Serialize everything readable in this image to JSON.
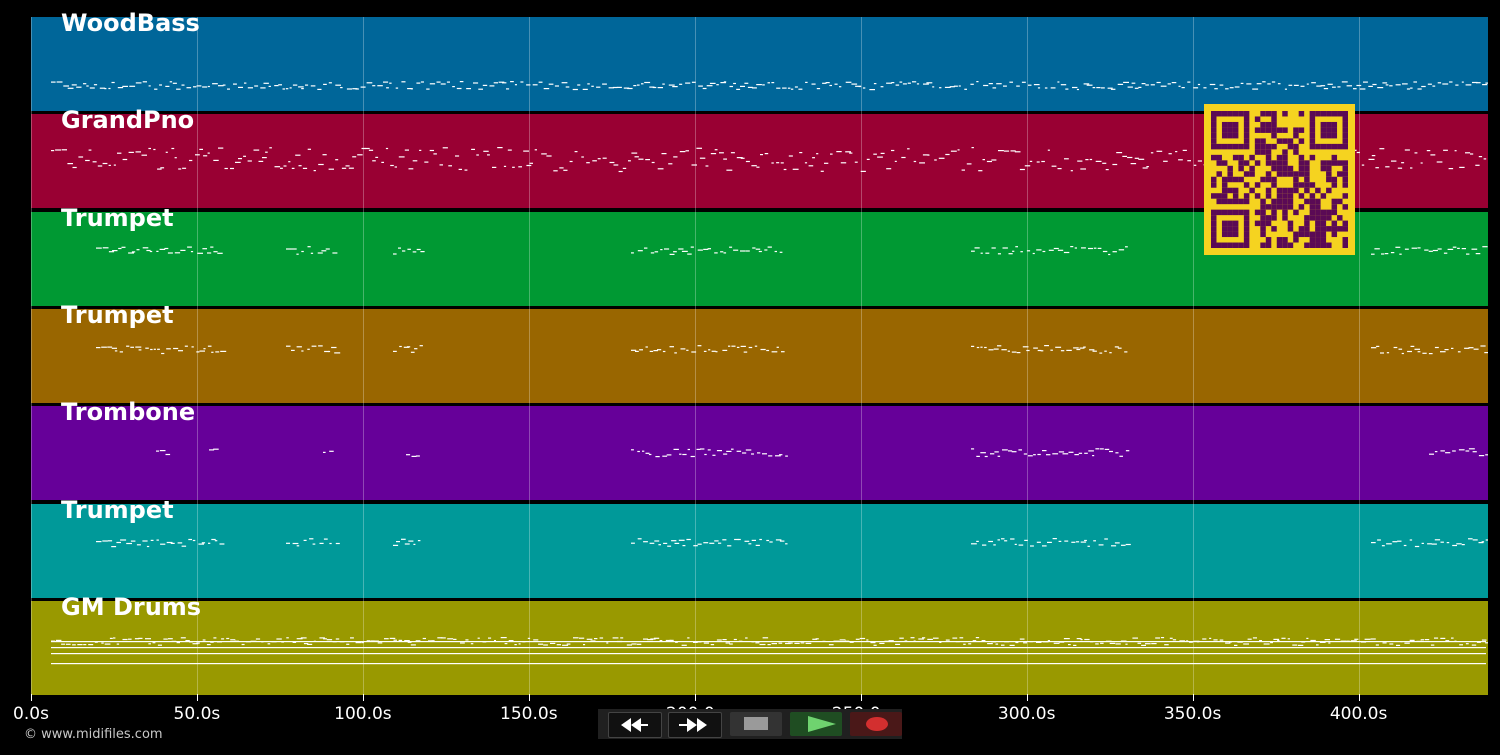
{
  "tracks": [
    {
      "name": "WoodBass",
      "color": "#006699"
    },
    {
      "name": "GrandPno",
      "color": "#990033"
    },
    {
      "name": "Trumpet",
      "color": "#009933"
    },
    {
      "name": "Trumpet",
      "color": "#996600"
    },
    {
      "name": "Trombone",
      "color": "#660099"
    },
    {
      "name": "Trumpet",
      "color": "#009999"
    },
    {
      "name": "GM Drums",
      "color": "#999900"
    }
  ],
  "timeline": {
    "ticks": [
      "0.0s",
      "50.0s",
      "100.0s",
      "150.0s",
      "200.0s",
      "250.0s",
      "300.0s",
      "350.0s",
      "400.0s"
    ],
    "max_seconds": 439
  },
  "transport": {
    "rewind_icon": "rewind-icon",
    "fast_forward_icon": "fast-forward-icon",
    "stop_icon": "stop-icon",
    "play_icon": "play-icon",
    "record_icon": "record-icon",
    "play_color": "#2e7d32",
    "record_color": "#d32f2f"
  },
  "qr": {
    "foreground": "#5a0a55",
    "background": "#f5d320"
  },
  "footer": {
    "copyright": "© www.midifiles.com"
  }
}
